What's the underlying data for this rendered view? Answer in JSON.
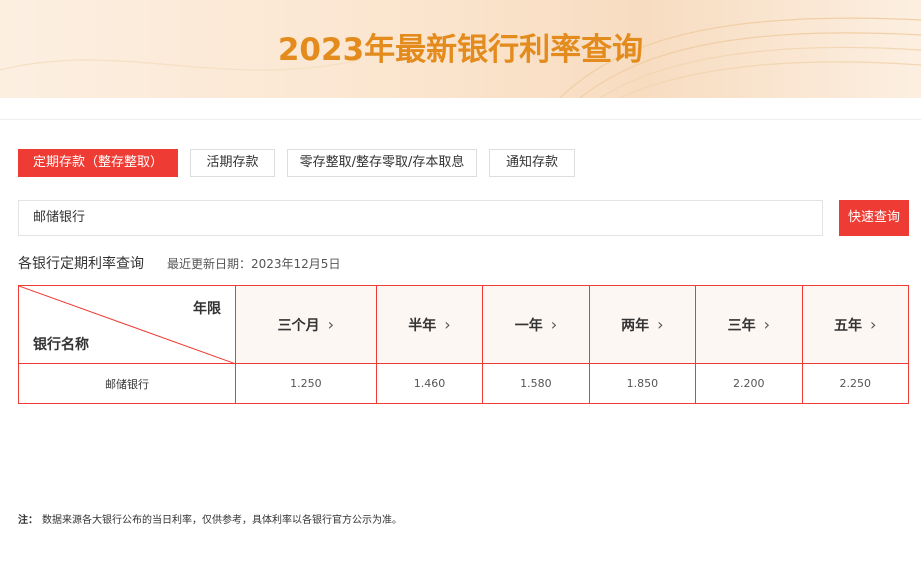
{
  "page": {
    "title": "2023年最新银行利率查询"
  },
  "tabs": [
    {
      "label": "定期存款（整存整取）",
      "active": true
    },
    {
      "label": "活期存款",
      "active": false
    },
    {
      "label": "零存整取/整存零取/存本取息",
      "active": false
    },
    {
      "label": "通知存款",
      "active": false
    }
  ],
  "search": {
    "value": "邮储银行",
    "button_label": "快速查询"
  },
  "section": {
    "title": "各银行定期利率查询",
    "update_date": "最近更新日期：2023年12月5日"
  },
  "table": {
    "corner_top": "年限",
    "corner_bottom": "银行名称",
    "terms": [
      "三个月",
      "半年",
      "一年",
      "两年",
      "三年",
      "五年"
    ],
    "rows": [
      {
        "bank": "邮储银行",
        "rates": [
          "1.250",
          "1.460",
          "1.580",
          "1.850",
          "2.200",
          "2.250"
        ]
      }
    ]
  },
  "note": {
    "label": "注：",
    "text": "数据来源各大银行公布的当日利率，仅供参考，具体利率以各银行官方公示为准。"
  },
  "colors": {
    "accent": "#ee3b33",
    "title": "#e38b1c",
    "banner_bg": "#fbe5cf"
  }
}
